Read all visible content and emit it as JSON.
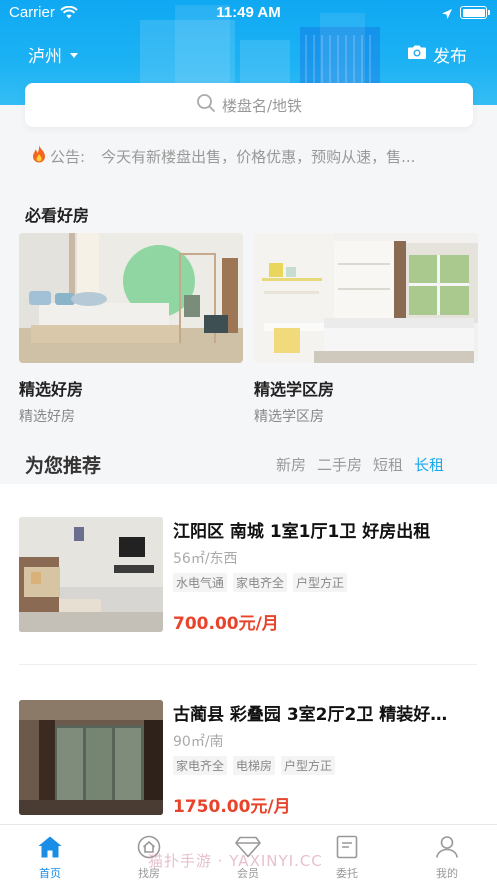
{
  "status_bar": {
    "carrier": "Carrier",
    "time": "11:49 AM"
  },
  "header": {
    "city": "泸州",
    "publish_label": "发布"
  },
  "search": {
    "placeholder": "楼盘名/地铁"
  },
  "notice": {
    "label": "公告:",
    "text": "今天有新楼盘出售，价格优惠，预购从速，售..."
  },
  "must_see": {
    "title": "必看好房",
    "cards": [
      {
        "title": "精选好房",
        "subtitle": "精选好房"
      },
      {
        "title": "精选学区房",
        "subtitle": "精选学区房"
      }
    ]
  },
  "recommend": {
    "title": "为您推荐",
    "tabs": [
      "新房",
      "二手房",
      "短租",
      "长租"
    ],
    "active_tab": "长租"
  },
  "listings": [
    {
      "title": "江阳区 南城  1室1厅1卫 好房出租",
      "meta": "56㎡/东西",
      "tags": [
        "水电气通",
        "家电齐全",
        "户型方正"
      ],
      "price": "700.00元/月"
    },
    {
      "title": "古蔺县 彩叠园 3室2厅2卫  精装好…",
      "meta": "90㎡/南",
      "tags": [
        "家电齐全",
        "电梯房",
        "户型方正"
      ],
      "price": "1750.00元/月"
    }
  ],
  "tab_bar": {
    "items": [
      "首页",
      "找房",
      "会员",
      "委托",
      "我的"
    ],
    "active": "首页"
  },
  "watermark": "猫扑手游 · YAXINYI.CC",
  "colors": {
    "header_blue": "#0fa8f2",
    "accent_blue": "#1aa7ee",
    "price_red": "#e8442c",
    "tab_active": "#1a8de6"
  }
}
